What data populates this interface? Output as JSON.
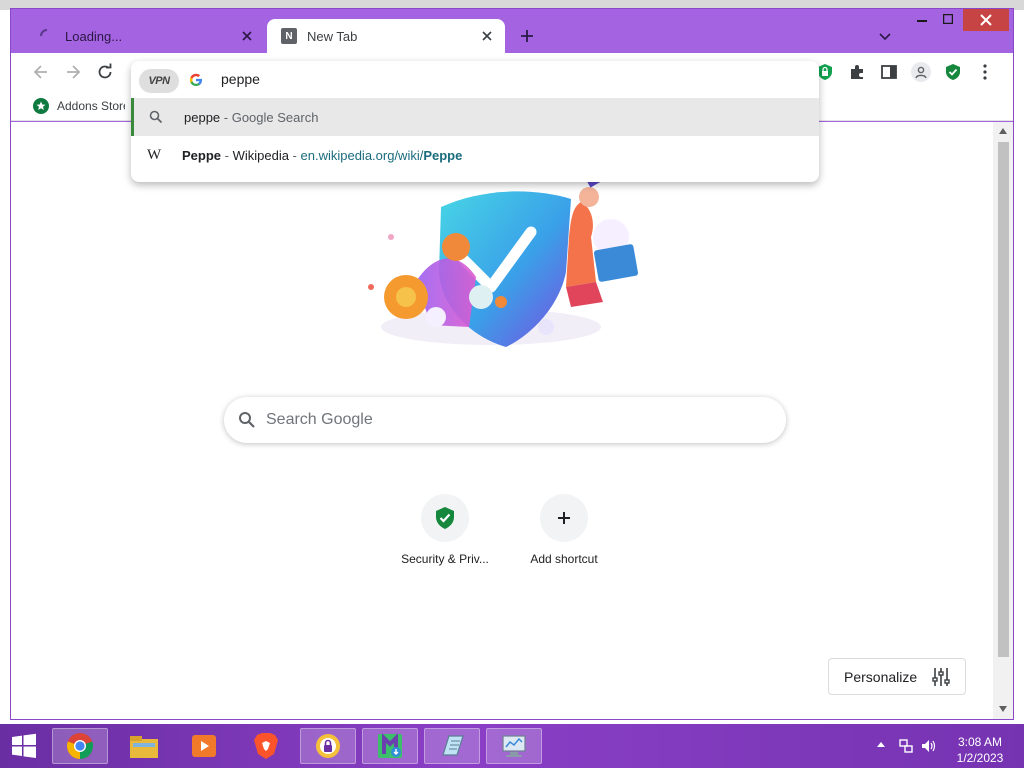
{
  "browser": {
    "tabs": [
      {
        "title": "Loading...",
        "active": false
      },
      {
        "title": "New Tab",
        "active": true,
        "favicon_letter": "N"
      }
    ],
    "accent_color": "#a463e0"
  },
  "omnibox": {
    "vpn_label": "VPN",
    "input_value": "peppe",
    "suggestions": [
      {
        "icon": "search-icon",
        "query": "peppe",
        "separator": " - ",
        "description": "Google Search"
      },
      {
        "icon": "wikipedia-icon",
        "glyph": "W",
        "query": "Peppe",
        "separator": " - ",
        "description": "Wikipedia",
        "sep2": " - ",
        "url_prefix": "en.wikipedia.org/wiki/",
        "url_bold": "Peppe"
      }
    ]
  },
  "bookmarks": {
    "items": [
      {
        "label": "Addons Store",
        "icon": "addons-store-icon"
      }
    ]
  },
  "ntp": {
    "search_placeholder": "Search Google",
    "shortcuts": [
      {
        "label": "Security & Priv...",
        "icon": "shield-check-icon"
      },
      {
        "label": "Add shortcut",
        "icon": "plus-icon"
      }
    ],
    "personalize_label": "Personalize"
  },
  "taskbar": {
    "apps": [
      "chrome-icon",
      "file-explorer-icon",
      "media-player-icon",
      "brave-icon",
      "vpn-app-icon",
      "installer-icon",
      "notepad-icon",
      "control-panel-icon"
    ],
    "time": "3:08 AM",
    "date": "1/2/2023"
  }
}
